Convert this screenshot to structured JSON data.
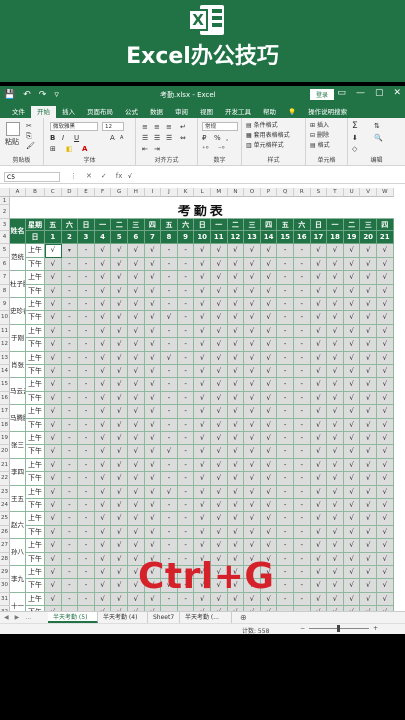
{
  "banner": {
    "icon_letter": "X",
    "title": "Excel办公技巧"
  },
  "titlebar": {
    "quick_access": [
      "💾",
      "↶",
      "↷",
      "▿"
    ],
    "document": "考勤.xlsx - Excel",
    "login": "登录",
    "window_controls": [
      "▭",
      "—",
      "▢",
      "✕"
    ]
  },
  "ribbon_tabs": [
    "文件",
    "开始",
    "插入",
    "页面布局",
    "公式",
    "数据",
    "审阅",
    "视图",
    "开发工具",
    "帮助",
    "💡",
    "操作说明搜索"
  ],
  "ribbon_active_tab": "开始",
  "ribbon": {
    "clipboard": {
      "label": "剪贴板",
      "paste": "粘贴"
    },
    "font": {
      "label": "字体",
      "font_name": "微软雅黑",
      "font_size": "12",
      "bold": "B",
      "italic": "I",
      "underline": "U",
      "grow": "A",
      "shrink": "A"
    },
    "alignment": {
      "label": "对齐方式"
    },
    "number": {
      "label": "数字",
      "format": "常规",
      "percent": "%"
    },
    "styles": {
      "label": "样式",
      "cond": "条件格式",
      "table": "套用表格格式",
      "cell": "单元格样式"
    },
    "cells": {
      "label": "单元格",
      "insert": "插入",
      "delete": "删除",
      "format": "格式"
    },
    "editing": {
      "label": "编辑",
      "sum": "Σ"
    }
  },
  "formula_bar": {
    "name_box": "C5",
    "icons": [
      "⋮",
      "✕",
      "✓",
      "fx"
    ],
    "value": "√"
  },
  "columns": [
    "A",
    "B",
    "C",
    "D",
    "E",
    "F",
    "G",
    "H",
    "I",
    "J",
    "K",
    "L",
    "M",
    "N",
    "O",
    "P",
    "Q",
    "R",
    "S",
    "T",
    "U",
    "V",
    "W"
  ],
  "row_numbers": [
    "1",
    "2",
    "3",
    "4",
    "5",
    "6",
    "7",
    "8",
    "9",
    "10",
    "11",
    "12",
    "13",
    "14",
    "15",
    "16",
    "17",
    "18",
    "19",
    "20",
    "21",
    "22",
    "23",
    "24",
    "25",
    "26",
    "27",
    "28",
    "29",
    "30",
    "31",
    "32"
  ],
  "sheet_title": "考勤表",
  "header": {
    "name_label": "姓名",
    "weekday_label": "星期",
    "day_label": "日",
    "weekdays": [
      "五",
      "六",
      "日",
      "一",
      "二",
      "三",
      "四",
      "五",
      "六",
      "日",
      "一",
      "二",
      "三",
      "四",
      "五",
      "六",
      "日",
      "一",
      "二",
      "三",
      "四"
    ],
    "days": [
      "1",
      "2",
      "3",
      "4",
      "5",
      "6",
      "7",
      "8",
      "9",
      "10",
      "11",
      "12",
      "13",
      "14",
      "15",
      "16",
      "17",
      "18",
      "19",
      "20",
      "21"
    ]
  },
  "period_labels": [
    "上午",
    "下午"
  ],
  "employees": [
    "范统",
    "杜子腾",
    "史珍香",
    "于刚",
    "肖张",
    "马云云",
    "马腾腾",
    "张三",
    "李四",
    "王五",
    "赵六",
    "孙八",
    "李九",
    "十一"
  ],
  "attendance_pattern": [
    "√▾-√√√√--√√√√√--√√√√",
    "√--√√√√--√√√√√--√√√√",
    "√--√√√√--√√√√√--√√√√",
    "√--√√√√--√√√√√--√√√√",
    "√--√√√√--√√√√√--√√√√",
    "√--√√√√√-√√√√√--√√√√",
    "√--√√√√--√√√√√--√√√√",
    "√--√√√√--√√√√√--√√√√",
    "√--√√√√√-√√√√√--√√√√",
    "√--√√√√--√√√√√--√√√√"
  ],
  "sheet_tabs": [
    "半天考勤 (5)",
    "半天考勤 (4)",
    "Sheet7",
    "半天考勤 (..."
  ],
  "sheet_nav": [
    "◀",
    "▶",
    "…"
  ],
  "sheet_add": "⊕",
  "status": {
    "count": "计数: 558",
    "zoom_minus": "−",
    "zoom_plus": "+"
  },
  "overlay_text": "Ctrl+G",
  "colors": {
    "excel_green": "#217346",
    "overlay_red": "#d4212a",
    "gray_cell": "#dcdcdc"
  }
}
